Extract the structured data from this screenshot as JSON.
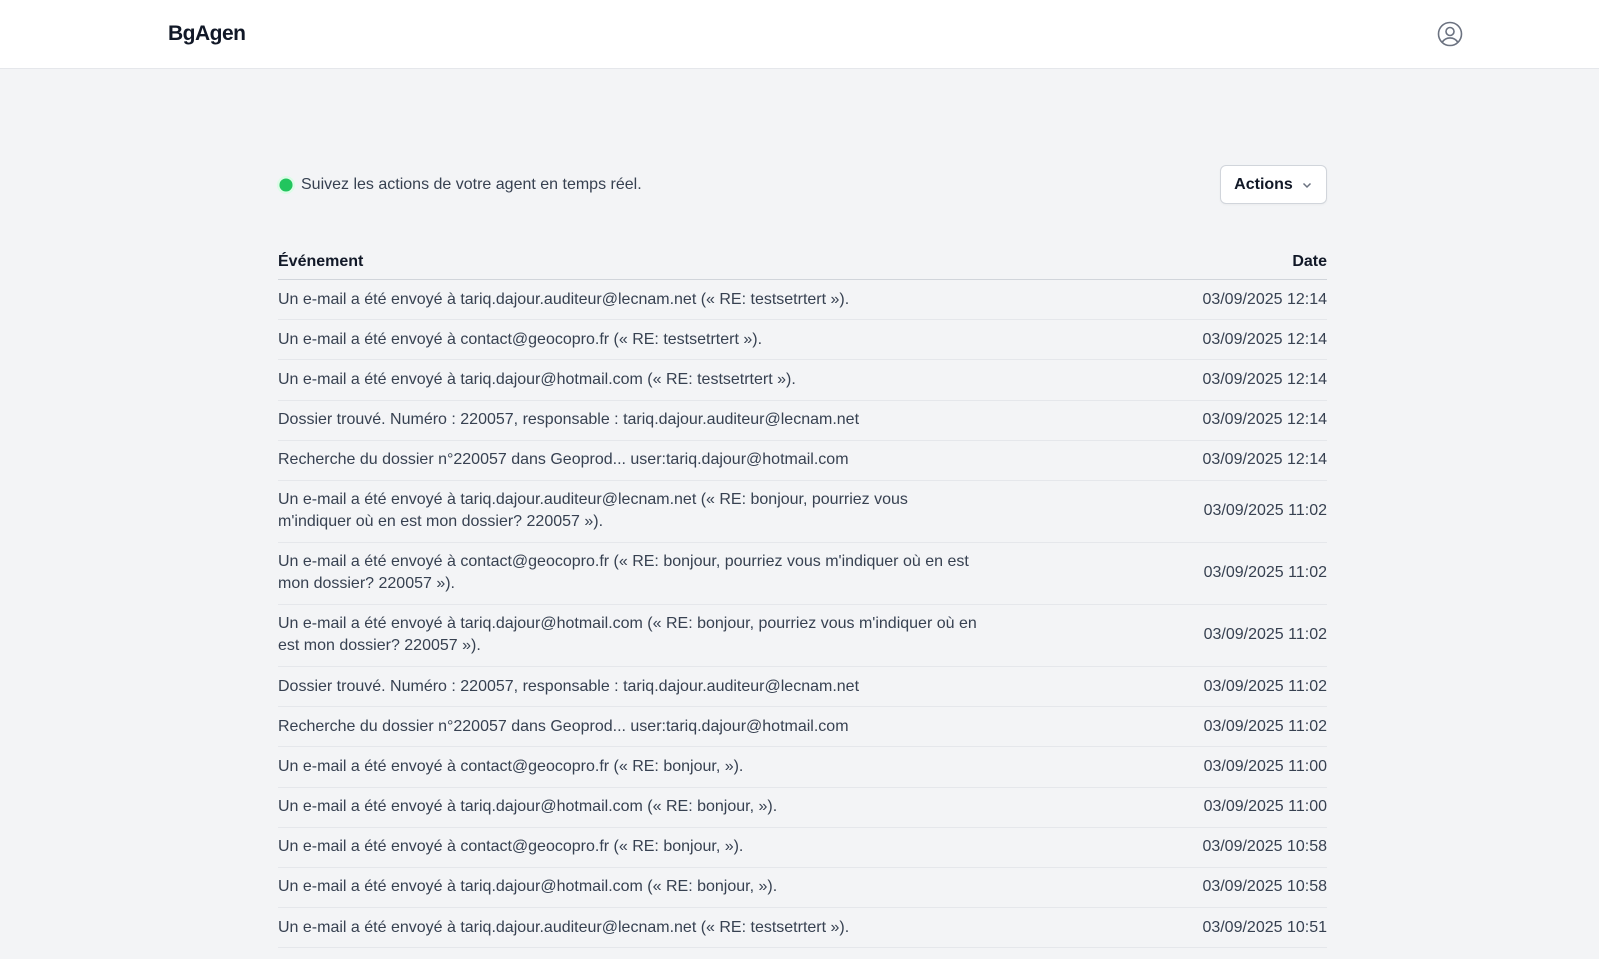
{
  "header": {
    "logo": "BgAgen",
    "user_icon": "user-circle-icon"
  },
  "status": {
    "text": "Suivez les actions de votre agent en temps réel.",
    "color": "#22c55e"
  },
  "toolbar": {
    "actions_label": "Actions",
    "actions_icon": "chevron-down-icon"
  },
  "table": {
    "col_event": "Événement",
    "col_date": "Date",
    "rows": [
      {
        "event": "Un e-mail a été envoyé à tariq.dajour.auditeur@lecnam.net (« RE: testsetrtert »).",
        "date": "03/09/2025 12:14"
      },
      {
        "event": "Un e-mail a été envoyé à contact@geocopro.fr (« RE: testsetrtert »).",
        "date": "03/09/2025 12:14"
      },
      {
        "event": "Un e-mail a été envoyé à tariq.dajour@hotmail.com (« RE: testsetrtert »).",
        "date": "03/09/2025 12:14"
      },
      {
        "event": "Dossier trouvé. Numéro : 220057, responsable : tariq.dajour.auditeur@lecnam.net",
        "date": "03/09/2025 12:14"
      },
      {
        "event": "Recherche du dossier n°220057 dans Geoprod... user:tariq.dajour@hotmail.com",
        "date": "03/09/2025 12:14"
      },
      {
        "event": "Un e-mail a été envoyé à tariq.dajour.auditeur@lecnam.net (« RE: bonjour, pourriez vous m'indiquer où en est mon dossier? 220057 »).",
        "date": "03/09/2025 11:02"
      },
      {
        "event": "Un e-mail a été envoyé à contact@geocopro.fr (« RE: bonjour, pourriez vous m'indiquer où en est mon dossier? 220057 »).",
        "date": "03/09/2025 11:02"
      },
      {
        "event": "Un e-mail a été envoyé à tariq.dajour@hotmail.com (« RE: bonjour, pourriez vous m'indiquer où en est mon dossier? 220057 »).",
        "date": "03/09/2025 11:02"
      },
      {
        "event": "Dossier trouvé. Numéro : 220057, responsable : tariq.dajour.auditeur@lecnam.net",
        "date": "03/09/2025 11:02"
      },
      {
        "event": "Recherche du dossier n°220057 dans Geoprod... user:tariq.dajour@hotmail.com",
        "date": "03/09/2025 11:02"
      },
      {
        "event": "Un e-mail a été envoyé à contact@geocopro.fr (« RE: bonjour, »).",
        "date": "03/09/2025 11:00"
      },
      {
        "event": "Un e-mail a été envoyé à tariq.dajour@hotmail.com (« RE: bonjour, »).",
        "date": "03/09/2025 11:00"
      },
      {
        "event": "Un e-mail a été envoyé à contact@geocopro.fr (« RE: bonjour, »).",
        "date": "03/09/2025 10:58"
      },
      {
        "event": "Un e-mail a été envoyé à tariq.dajour@hotmail.com (« RE: bonjour, »).",
        "date": "03/09/2025 10:58"
      },
      {
        "event": "Un e-mail a été envoyé à tariq.dajour.auditeur@lecnam.net (« RE: testsetrtert »).",
        "date": "03/09/2025 10:51"
      }
    ]
  }
}
